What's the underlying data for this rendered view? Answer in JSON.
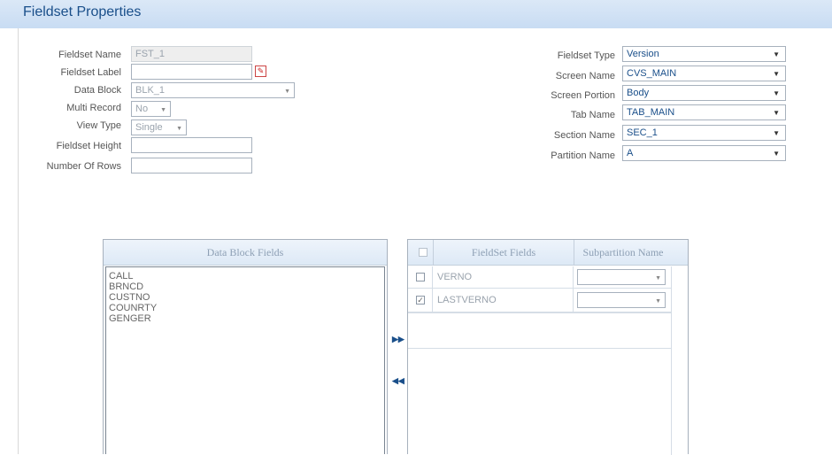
{
  "header": {
    "title": "Fieldset Properties"
  },
  "left_form": {
    "fieldset_name": {
      "label": "Fieldset Name",
      "value": "FST_1"
    },
    "fieldset_label": {
      "label": "Fieldset Label",
      "value": ""
    },
    "data_block": {
      "label": "Data Block",
      "value": "BLK_1"
    },
    "multi_record": {
      "label": "Multi Record",
      "value": "No"
    },
    "view_type": {
      "label": "View Type",
      "value": "Single"
    },
    "fieldset_height": {
      "label": "Fieldset Height",
      "value": ""
    },
    "number_of_rows": {
      "label": "Number Of Rows",
      "value": ""
    }
  },
  "right_form": {
    "fieldset_type": {
      "label": "Fieldset Type",
      "value": "Version"
    },
    "screen_name": {
      "label": "Screen Name",
      "value": "CVS_MAIN"
    },
    "screen_portion": {
      "label": "Screen Portion",
      "value": "Body"
    },
    "tab_name": {
      "label": "Tab Name",
      "value": "TAB_MAIN"
    },
    "section_name": {
      "label": "Section Name",
      "value": "SEC_1"
    },
    "partition_name": {
      "label": "Partition Name",
      "value": "A"
    }
  },
  "data_block_fields": {
    "title": "Data Block Fields",
    "items": [
      "CALL",
      "BRNCD",
      "CUSTNO",
      "COUNRTY",
      "GENGER"
    ]
  },
  "fieldset_fields": {
    "col_field": "FieldSet Fields",
    "col_subpartition": "Subpartition Name",
    "rows": [
      {
        "name": "VERNO",
        "checked": false,
        "subpartition": ""
      },
      {
        "name": "LASTVERNO",
        "checked": true,
        "subpartition": ""
      }
    ]
  },
  "icons": {
    "add": "double-right-arrow",
    "remove": "double-left-arrow",
    "lookup": "lookup-icon"
  },
  "colors": {
    "header_bg": "#c8dcf3",
    "title": "#1a4f8a",
    "value_blue": "#1a4f8a"
  }
}
